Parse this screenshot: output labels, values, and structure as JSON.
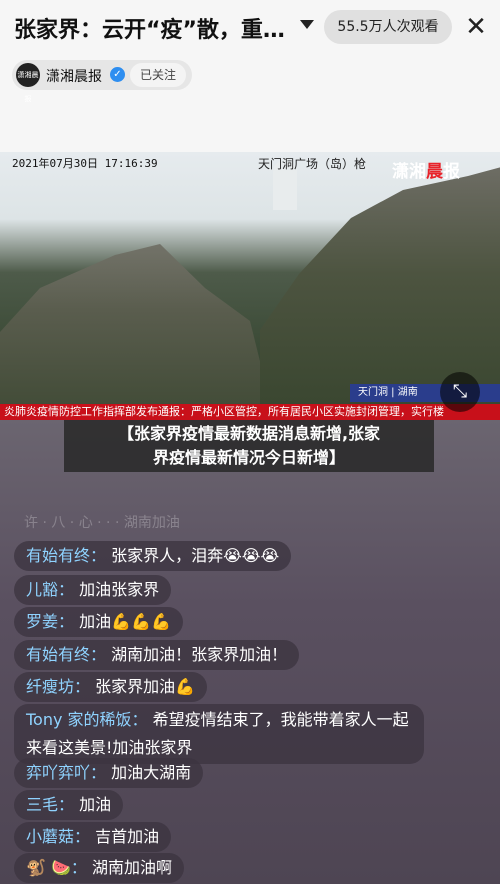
{
  "header": {
    "title": "张家界：云开“疫”散，重…",
    "viewers": "55.5万人次观看",
    "close_label": "✕"
  },
  "channel": {
    "logo_text": "潇湘晨报",
    "name": "潇湘晨报",
    "follow_label": "已关注"
  },
  "video": {
    "timestamp": "2021年07月30日 17:16:39",
    "location": "天门洞广场（岛）枪",
    "watermark_part1": "潇湘",
    "watermark_part2": "晨",
    "watermark_part3": "报",
    "ticker_blue": "天门洞 | 湖南",
    "ticker_red": "炎肺炎疫情防控工作指挥部发布通报：严格小区管控，所有居民小区实施封闭管理，实行楼"
  },
  "headline": {
    "line1": "【张家界疫情最新数据消息新增,张家",
    "line2": "界疫情最新情况今日新增】"
  },
  "chat": {
    "faded": "许 · 八 · 心  · · · 湖南加油",
    "messages": [
      {
        "user": "有始有终：",
        "text": "张家界人，泪奔😭😭😭"
      },
      {
        "user": "儿豁：",
        "text": "加油张家界"
      },
      {
        "user": "罗姜：",
        "text": "加油💪💪💪"
      },
      {
        "user": "有始有终：",
        "text": "湖南加油！张家界加油！"
      },
      {
        "user": "纤瘦坊：",
        "text": "张家界加油💪"
      },
      {
        "user": "Tony 家的稀饭：",
        "text": "希望疫情结束了，我能带着家人一起来看这美景!加油张家界"
      },
      {
        "user": "弈吖弈吖：",
        "text": "加油大湖南"
      },
      {
        "user": "三毛：",
        "text": "加油"
      },
      {
        "user": "小蘑菇：",
        "text": "吉首加油"
      },
      {
        "user": "🐒 🍉：",
        "text": "湖南加油啊"
      }
    ]
  }
}
